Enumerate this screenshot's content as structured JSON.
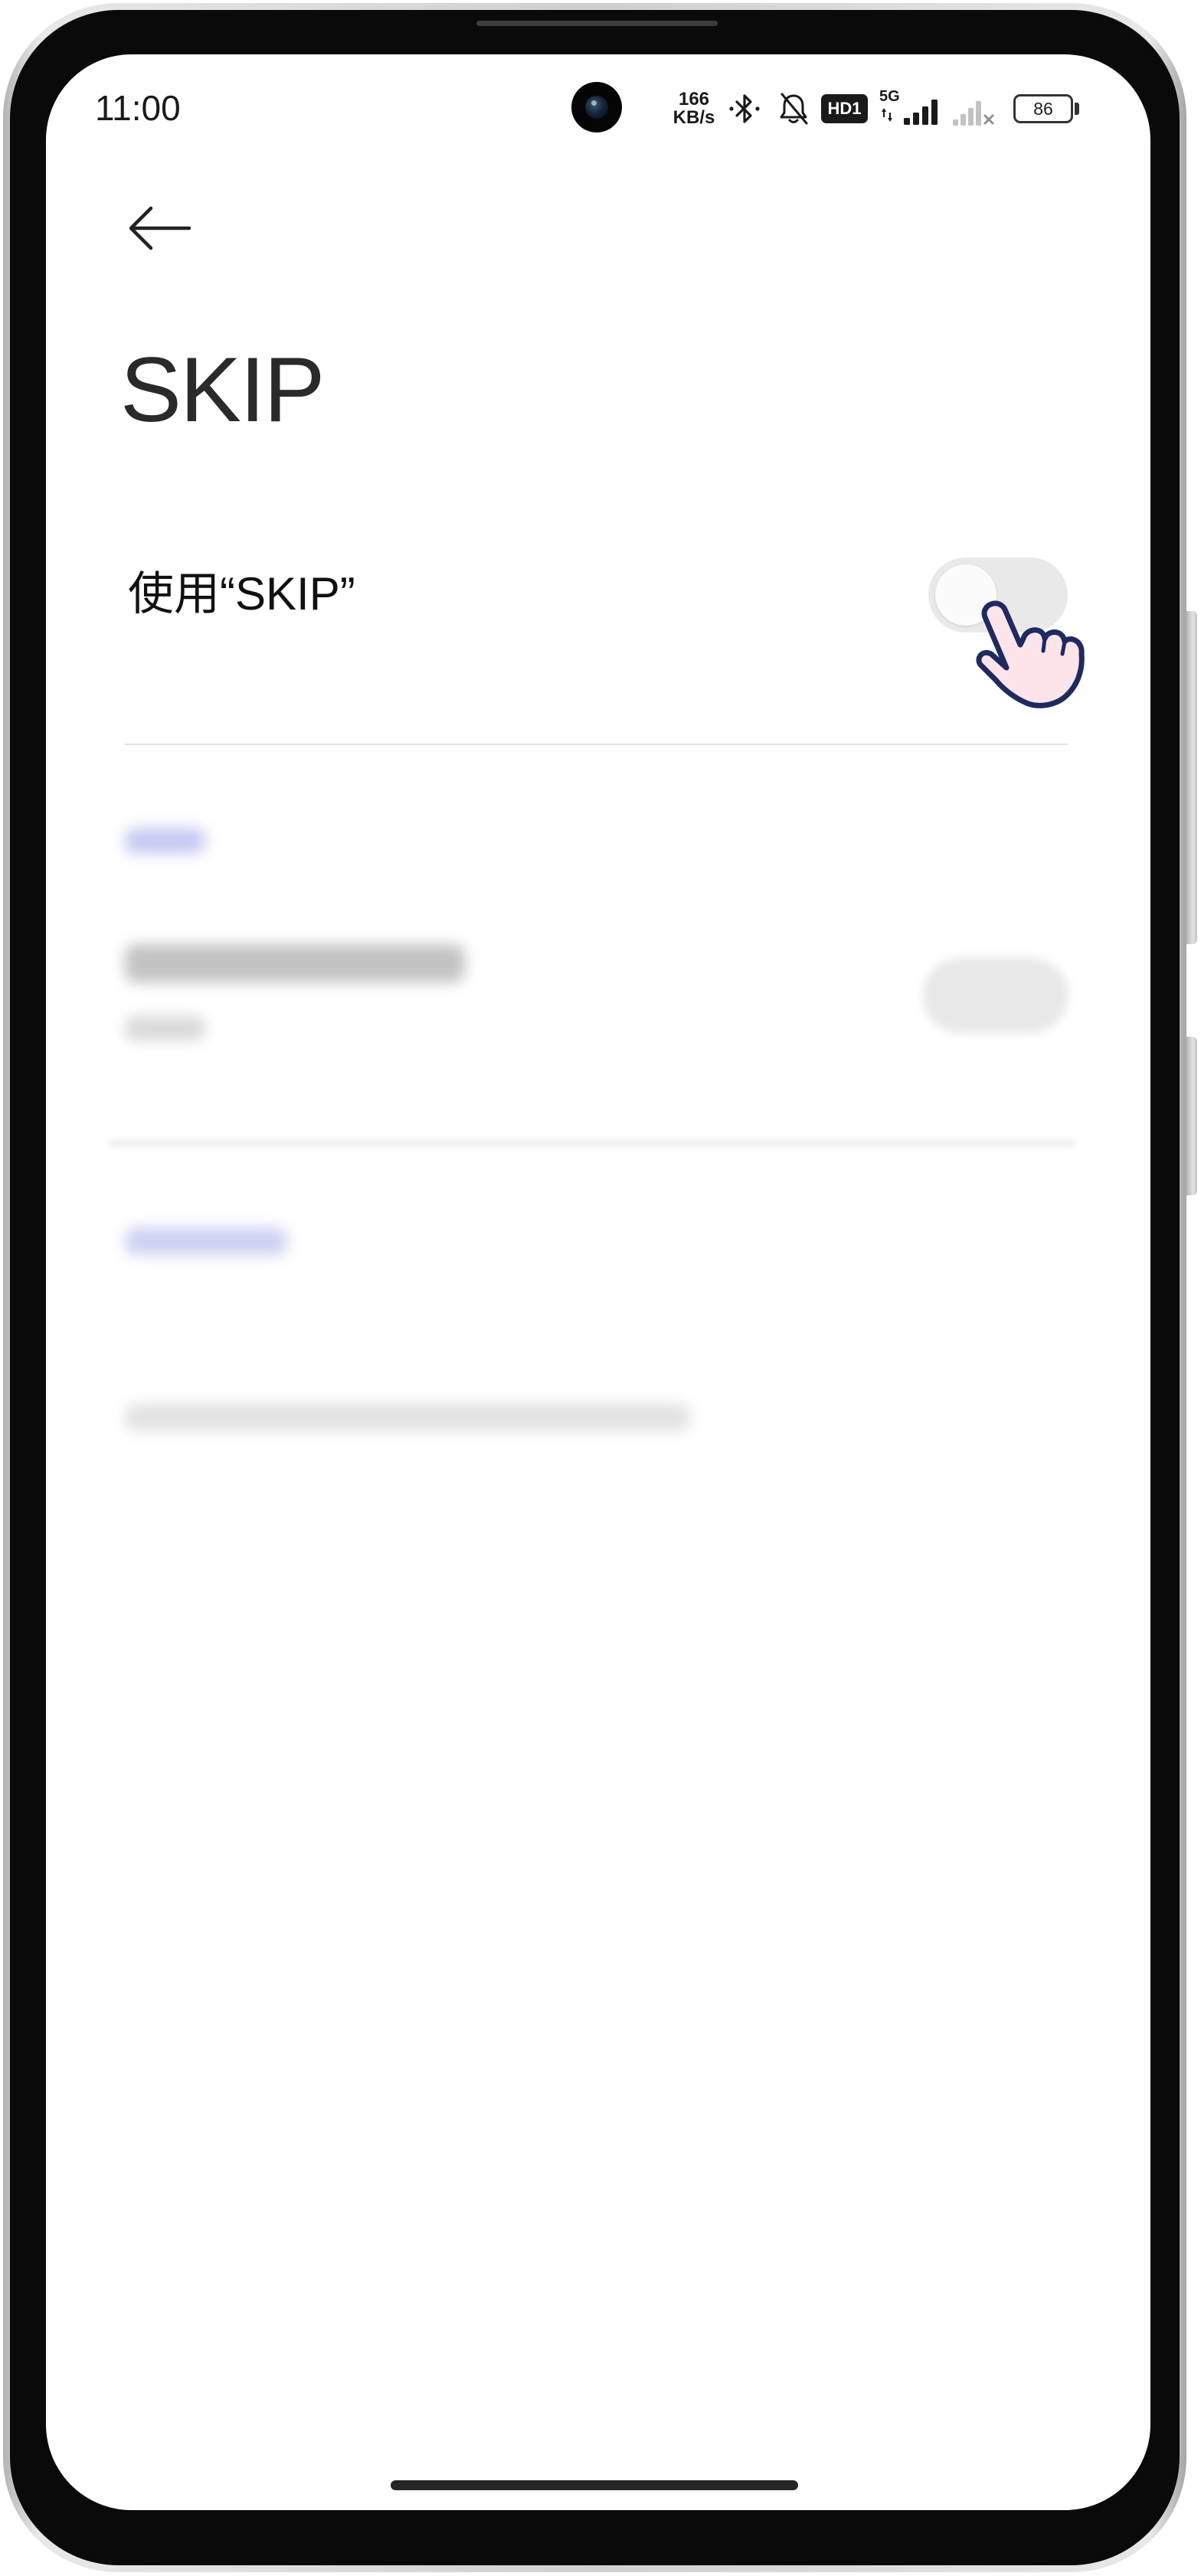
{
  "status_bar": {
    "time": "11:00",
    "net_speed": {
      "value": "166",
      "unit": "KB/s"
    },
    "hd_badge": "HD1",
    "network_type": "5G",
    "battery_level": "86",
    "icons": {
      "bluetooth": "bluetooth-icon",
      "notifications": "bell-muted-icon",
      "signal_primary": "signal-icon",
      "signal_secondary": "signal-no-service-icon",
      "battery": "battery-icon"
    }
  },
  "header": {
    "back_icon": "arrow-left-icon",
    "title": "SKIP"
  },
  "settings": {
    "enable_toggle": {
      "label": "使用“SKIP”",
      "on": false
    },
    "pointer_icon": "pointer-hand-icon"
  },
  "colors": {
    "text_primary": "#1a1a1a",
    "toggle_off_track": "#e9e9e9",
    "blurred_accent": "#b3b8ec",
    "pointer_outline": "#1f2a5e",
    "pointer_fill": "#fde4ea",
    "home_indicator": "#262626"
  }
}
